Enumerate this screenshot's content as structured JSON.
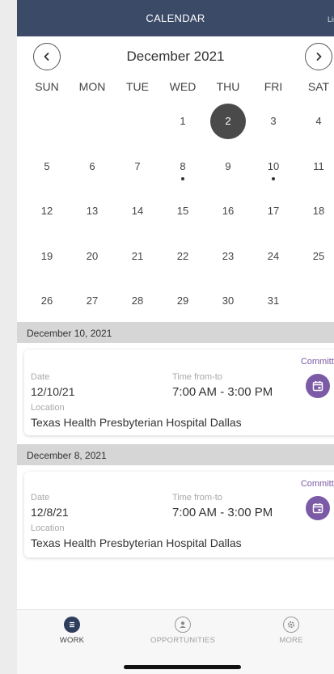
{
  "header": {
    "title": "CALENDAR",
    "right_link": "List"
  },
  "calendar": {
    "month_label": "December 2021",
    "weekdays": [
      "SUN",
      "MON",
      "TUE",
      "WED",
      "THU",
      "FRI",
      "SAT"
    ],
    "weeks": [
      [
        "",
        "",
        "",
        "1",
        "2",
        "3",
        "4"
      ],
      [
        "5",
        "6",
        "7",
        "8",
        "9",
        "10",
        "11"
      ],
      [
        "12",
        "13",
        "14",
        "15",
        "16",
        "17",
        "18"
      ],
      [
        "19",
        "20",
        "21",
        "22",
        "23",
        "24",
        "25"
      ],
      [
        "26",
        "27",
        "28",
        "29",
        "30",
        "31",
        ""
      ]
    ],
    "selected_day": "2",
    "days_with_events": [
      "8",
      "10"
    ]
  },
  "events": [
    {
      "section_date": "December 10, 2021",
      "status": "Committed",
      "date_label": "Date",
      "date": "12/10/21",
      "time_label": "Time from-to",
      "time": "7:00 AM - 3:00 PM",
      "location_label": "Location",
      "location": "Texas Health Presbyterian Hospital Dallas"
    },
    {
      "section_date": "December 8, 2021",
      "status": "Committed",
      "date_label": "Date",
      "date": "12/8/21",
      "time_label": "Time from-to",
      "time": "7:00 AM - 3:00 PM",
      "location_label": "Location",
      "location": "Texas Health Presbyterian Hospital Dallas"
    }
  ],
  "tabbar": {
    "tabs": [
      {
        "label": "WORK",
        "icon": "list-icon",
        "active": true
      },
      {
        "label": "OPPORTUNITIES",
        "icon": "person-icon",
        "active": false
      },
      {
        "label": "MORE",
        "icon": "gear-icon",
        "active": false
      }
    ]
  },
  "colors": {
    "header_bg": "#3b4a66",
    "accent_purple": "#7b5aa6",
    "selected_day": "#4a4a4a"
  }
}
